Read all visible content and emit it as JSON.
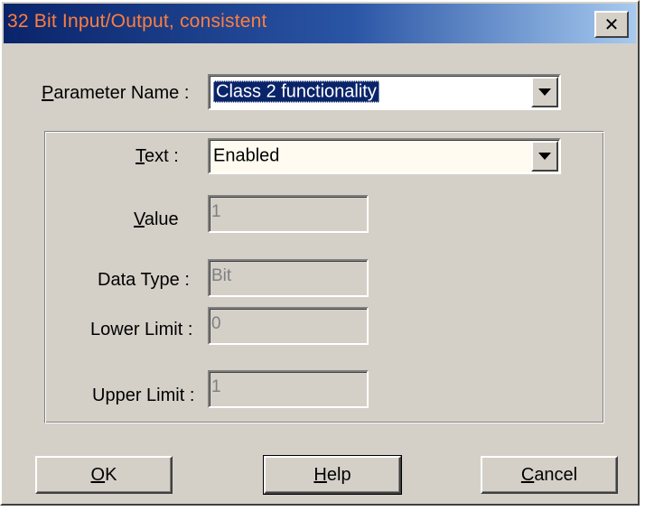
{
  "window": {
    "title": "32 Bit Input/Output, consistent",
    "close_label": "✕",
    "title_color": "#ff7e3e"
  },
  "parameter": {
    "label_accel": "P",
    "label_rest": "arameter Name :",
    "value": "Class 2 functionality"
  },
  "text": {
    "label_accel": "T",
    "label_rest": "ext :",
    "value": "Enabled"
  },
  "value": {
    "label_accel": "V",
    "label_rest": "alue",
    "value": "1"
  },
  "data_type": {
    "label": "Data Type :",
    "value": "Bit"
  },
  "lower_limit": {
    "label": "Lower Limit :",
    "value": "0"
  },
  "upper_limit": {
    "label": "Upper Limit :",
    "value": "1"
  },
  "buttons": {
    "ok_accel": "O",
    "ok_rest": "K",
    "help_accel": "H",
    "help_rest": "elp",
    "cancel_accel": "C",
    "cancel_rest": "ancel"
  },
  "icons": {
    "dropdown": "chevron-down-icon",
    "close": "close-icon"
  }
}
